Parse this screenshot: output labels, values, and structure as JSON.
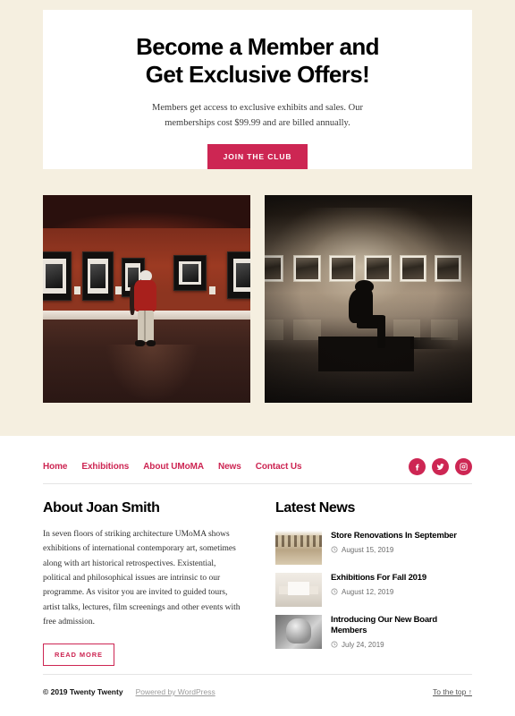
{
  "hero": {
    "title_line1": "Become a Member and",
    "title_line2": "Get Exclusive Offers!",
    "subtitle": "Members get access to exclusive exhibits and sales. Our memberships cost $99.99 and are billed annually.",
    "cta_label": "JOIN THE CLUB",
    "accent_color": "#CD2653"
  },
  "gallery": {
    "images": [
      {
        "alt": "Museum visitor in red jacket viewing framed artworks on a rust-red wall",
        "name": "gallery-photo-red-room"
      },
      {
        "alt": "Silhouette of a seated person looking at a row of framed photographs in a dim sepia gallery",
        "name": "gallery-photo-sepia-room"
      }
    ]
  },
  "nav": {
    "items": [
      {
        "label": "Home"
      },
      {
        "label": "Exhibitions"
      },
      {
        "label": "About UMoMA"
      },
      {
        "label": "News"
      },
      {
        "label": "Contact Us"
      }
    ],
    "socials": [
      {
        "name": "facebook-icon",
        "label": "Facebook"
      },
      {
        "name": "twitter-icon",
        "label": "Twitter"
      },
      {
        "name": "instagram-icon",
        "label": "Instagram"
      }
    ]
  },
  "about": {
    "heading": "About Joan Smith",
    "body": "In seven floors of striking architecture UMoMA shows exhibitions of international contemporary art, sometimes along with art historical retrospectives. Existential, political and philosophical issues are intrinsic to our programme. As visitor you are invited to guided tours, artist talks, lectures, film screenings and other events with free admission.",
    "read_more_label": "READ MORE"
  },
  "news": {
    "heading": "Latest News",
    "items": [
      {
        "title": "Store Renovations In September",
        "date": "August 15, 2019",
        "thumb": "gallery-hall"
      },
      {
        "title": "Exhibitions For Fall 2019",
        "date": "August 12, 2019",
        "thumb": "white-room"
      },
      {
        "title": "Introducing Our New Board Members",
        "date": "July 24, 2019",
        "thumb": "statue"
      }
    ]
  },
  "footer": {
    "copyright": "© 2019 Twenty Twenty",
    "powered_by": "Powered by WordPress",
    "to_top": "To the top ↑"
  }
}
